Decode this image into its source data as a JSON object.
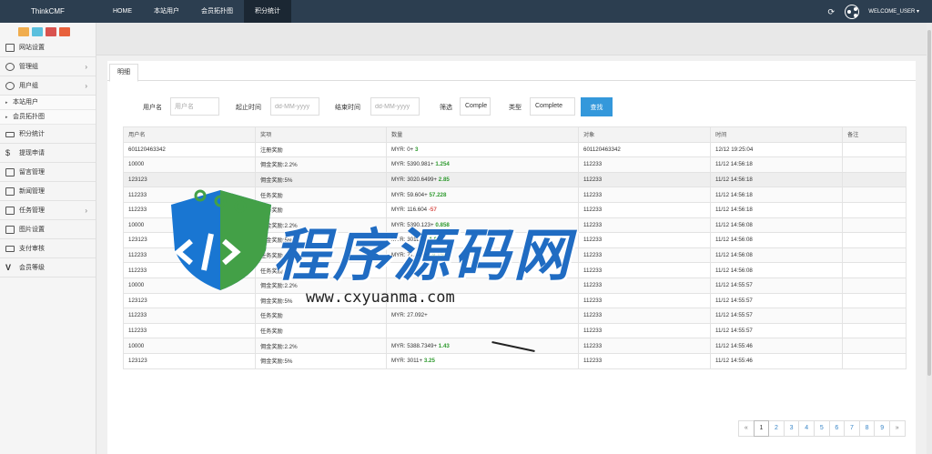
{
  "brand": "ThinkCMF",
  "topnav": {
    "items": [
      {
        "label": "HOME"
      },
      {
        "label": "本站用户"
      },
      {
        "label": "会员拓扑图"
      },
      {
        "label": "积分统计"
      }
    ]
  },
  "user": {
    "welcome": "WELCOME_USER"
  },
  "quick_colors": [
    "#f0ad4e",
    "#5bc0de",
    "#d9534f",
    "#e8613c"
  ],
  "sidebar": {
    "items": [
      {
        "label": "网站设置",
        "icon": "monitor-icon"
      },
      {
        "label": "管理组",
        "icon": "user-circle-icon",
        "arrow": "›"
      },
      {
        "label": "用户组",
        "icon": "user-circle-icon",
        "arrow": "›"
      },
      {
        "label": "本站用户",
        "icon": "bullet-icon"
      },
      {
        "label": "会员拓扑图",
        "icon": "bullet-icon"
      },
      {
        "label": "积分统计",
        "icon": "keyboard-icon"
      },
      {
        "label": "提现申请",
        "icon": "dollar-icon"
      },
      {
        "label": "留言管理",
        "icon": "envelope-icon"
      },
      {
        "label": "新闻管理",
        "icon": "newspaper-icon"
      },
      {
        "label": "任务管理",
        "icon": "tasks-icon",
        "arrow": "›"
      },
      {
        "label": "图片设置",
        "icon": "image-icon"
      },
      {
        "label": "支付审核",
        "icon": "card-icon"
      },
      {
        "label": "会员等级",
        "icon": "vimeo-icon"
      }
    ]
  },
  "tabs": [
    {
      "label": "明细"
    }
  ],
  "filter": {
    "username_label": "用户名",
    "username_placeholder": "用户名",
    "start_label": "起止时间",
    "start_placeholder": "dd-MM-yyyy",
    "end_label": "结束时间",
    "end_placeholder": "dd-MM-yyyy",
    "filter_label": "筛选",
    "filter_value": "Comple",
    "type_label": "类型",
    "type_value": "Complete",
    "search_label": "查找"
  },
  "table": {
    "columns": [
      "用户名",
      "奖项",
      "数量",
      "对象",
      "时间",
      "备注"
    ],
    "rows": [
      {
        "user": "601120463342",
        "award": "注册奖励",
        "base": "MYR: 0+",
        "delta": "3",
        "sign": "pos",
        "target": "601120463342",
        "time": "12/12 19:25:04",
        "note": ""
      },
      {
        "user": "10000",
        "award": "佣金奖励:2.2%",
        "base": "MYR: 5390.981+",
        "delta": "1.254",
        "sign": "pos",
        "target": "112233",
        "time": "11/12 14:56:18",
        "note": ""
      },
      {
        "user": "123123",
        "award": "佣金奖励:5%",
        "base": "MYR: 3020.6499+",
        "delta": "2.85",
        "sign": "pos",
        "target": "112233",
        "time": "11/12 14:56:18",
        "note": ""
      },
      {
        "user": "112233",
        "award": "任务奖励",
        "base": "MYR: 59.604+",
        "delta": "57.228",
        "sign": "pos",
        "target": "112233",
        "time": "11/12 14:56:18",
        "note": ""
      },
      {
        "user": "112233",
        "award": "任务奖励",
        "base": "MYR: 116.604",
        "delta": "-57",
        "sign": "neg",
        "target": "112233",
        "time": "11/12 14:56:18",
        "note": ""
      },
      {
        "user": "10000",
        "award": "佣金奖励:2.2%",
        "base": "MYR: 5390.123+",
        "delta": "0.858",
        "sign": "pos",
        "target": "112233",
        "time": "11/12 14:56:08",
        "note": ""
      },
      {
        "user": "123123",
        "award": "佣金奖励:5%",
        "base": "MYR: 3018.7+",
        "delta": "1.95",
        "sign": "pos",
        "target": "112233",
        "time": "11/12 14:56:08",
        "note": ""
      },
      {
        "user": "112233",
        "award": "任务奖励",
        "base": "MYR: 77.448+",
        "delta": "39.156",
        "sign": "pos",
        "target": "112233",
        "time": "11/12 14:56:08",
        "note": ""
      },
      {
        "user": "112233",
        "award": "任务奖励",
        "base": "",
        "delta": "",
        "sign": "pos",
        "target": "112233",
        "time": "11/12 14:56:08",
        "note": ""
      },
      {
        "user": "10000",
        "award": "佣金奖励:2.2%",
        "base": "",
        "delta": "",
        "sign": "pos",
        "target": "112233",
        "time": "11/12 14:55:57",
        "note": ""
      },
      {
        "user": "123123",
        "award": "佣金奖励:5%",
        "base": "",
        "delta": "",
        "sign": "pos",
        "target": "112233",
        "time": "11/12 14:55:57",
        "note": ""
      },
      {
        "user": "112233",
        "award": "任务奖励",
        "base": "MYR: 27.092+",
        "delta": "",
        "sign": "pos",
        "target": "112233",
        "time": "11/12 14:55:57",
        "note": ""
      },
      {
        "user": "112233",
        "award": "任务奖励",
        "base": "",
        "delta": "",
        "sign": "pos",
        "target": "112233",
        "time": "11/12 14:55:57",
        "note": ""
      },
      {
        "user": "10000",
        "award": "佣金奖励:2.2%",
        "base": "MYR: 5388.7349+",
        "delta": "1.43",
        "sign": "pos",
        "target": "112233",
        "time": "11/12 14:55:46",
        "note": ""
      },
      {
        "user": "123123",
        "award": "佣金奖励:5%",
        "base": "MYR: 3011+",
        "delta": "3.25",
        "sign": "pos",
        "target": "112233",
        "time": "11/12 14:55:46",
        "note": ""
      }
    ]
  },
  "pagination": {
    "prev": "«",
    "pages": [
      "1",
      "2",
      "3",
      "4",
      "5",
      "6",
      "7",
      "8",
      "9"
    ],
    "next": "»",
    "current": "1"
  },
  "watermark": {
    "cn": "程序源码网",
    "url": "www.cxyuanma.com"
  }
}
